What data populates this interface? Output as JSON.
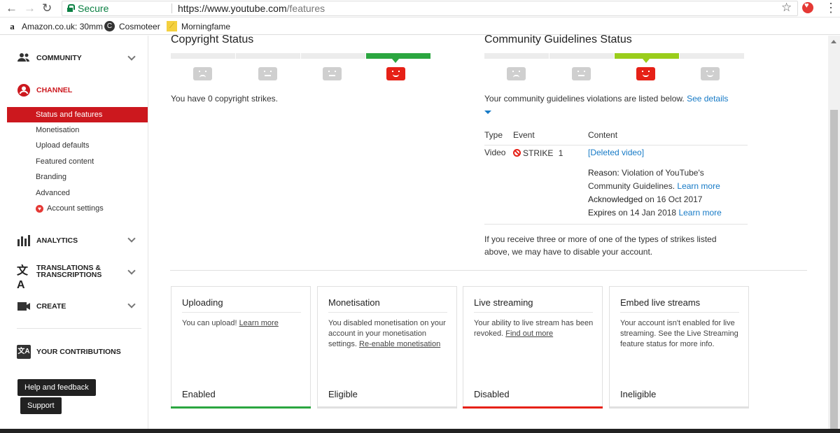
{
  "browser": {
    "secure_label": "Secure",
    "url_host": "https://www.youtube.com",
    "url_path": "/features",
    "bookmarks": [
      "Amazon.co.uk: 30mm",
      "Cosmoteer",
      "Morningfame"
    ]
  },
  "sidebar": {
    "community": "COMMUNITY",
    "channel": "CHANNEL",
    "channel_items": [
      "Status and features",
      "Monetisation",
      "Upload defaults",
      "Featured content",
      "Branding",
      "Advanced",
      "Account settings"
    ],
    "analytics": "ANALYTICS",
    "translations_line1": "TRANSLATIONS &",
    "translations_line2": "TRANSCRIPTIONS",
    "create": "CREATE",
    "contributions": "YOUR CONTRIBUTIONS",
    "help": "Help and feedback",
    "support": "Support"
  },
  "copyright": {
    "title": "Copyright Status",
    "message": "You have 0 copyright strikes."
  },
  "community": {
    "title": "Community Guidelines Status",
    "message": "Your community guidelines violations are listed below.",
    "see_details": "See details",
    "headers": {
      "type": "Type",
      "event": "Event",
      "content": "Content"
    },
    "row": {
      "type": "Video",
      "event": "STRIKE",
      "count": "1",
      "content": "[Deleted video]",
      "reason_label": "Reason:",
      "reason_line1": "Violation of YouTube's",
      "reason_line2": "Community Guidelines.",
      "learn_more": "Learn more",
      "ack_label": "Acknowledged",
      "ack_value": "on 16 Oct 2017",
      "expires_label": "Expires",
      "expires_value": "on 14 Jan 2018",
      "learn_more2": "Learn more"
    },
    "warning_line1": "If you receive three or more of one of the types of strikes listed",
    "warning_line2": "above, we may have to disable your account."
  },
  "cards": [
    {
      "title": "Uploading",
      "desc": "You can upload!",
      "link": "Learn more",
      "status": "Enabled",
      "color": "#2ba640"
    },
    {
      "title": "Monetisation",
      "desc": "You disabled monetisation on your account in your monetisation settings.",
      "link": "Re-enable monetisation",
      "status": "Eligible",
      "color": "#e0e0e0"
    },
    {
      "title": "Live streaming",
      "desc": "Your ability to live stream has been revoked.",
      "link": "Find out more",
      "status": "Disabled",
      "color": "#e62117"
    },
    {
      "title": "Embed live streams",
      "desc": "Your account isn't enabled for live streaming. See the Live Streaming feature status for more info.",
      "link": "",
      "status": "Ineligible",
      "color": "#e0e0e0"
    }
  ]
}
